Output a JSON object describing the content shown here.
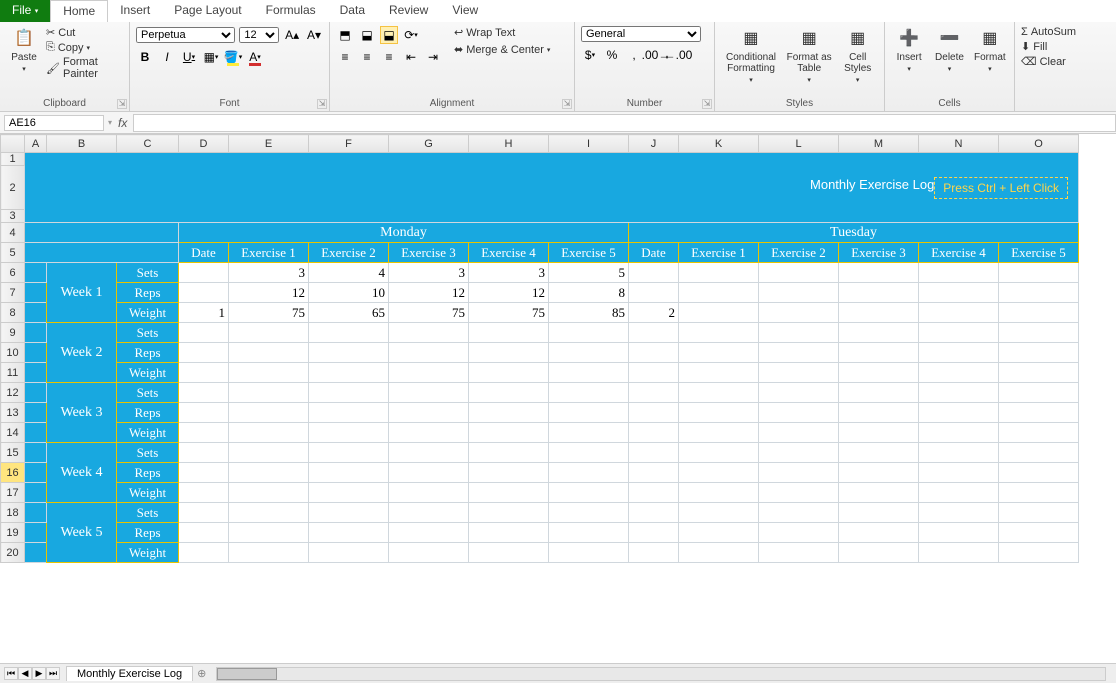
{
  "menu": {
    "file": "File",
    "tabs": [
      "Home",
      "Insert",
      "Page Layout",
      "Formulas",
      "Data",
      "Review",
      "View"
    ],
    "active": "Home"
  },
  "ribbon": {
    "clipboard": {
      "paste": "Paste",
      "cut": "Cut",
      "copy": "Copy",
      "painter": "Format Painter",
      "label": "Clipboard"
    },
    "font": {
      "name": "Perpetua",
      "size": "12",
      "bold": "B",
      "italic": "I",
      "underline": "U",
      "label": "Font"
    },
    "alignment": {
      "wrap": "Wrap Text",
      "merge": "Merge & Center",
      "label": "Alignment"
    },
    "number": {
      "format": "General",
      "currency": "$",
      "percent": "%",
      "comma": ",",
      "label": "Number"
    },
    "styles": {
      "cond": "Conditional Formatting",
      "table": "Format as Table",
      "cell": "Cell Styles",
      "label": "Styles"
    },
    "cells": {
      "insert": "Insert",
      "delete": "Delete",
      "format": "Format",
      "label": "Cells"
    },
    "editing": {
      "autosum": "AutoSum",
      "fill": "Fill",
      "clear": "Clear"
    }
  },
  "formula_bar": {
    "name_box": "AE16",
    "fx": "fx"
  },
  "columns": [
    "A",
    "B",
    "C",
    "D",
    "E",
    "F",
    "G",
    "H",
    "I",
    "J",
    "K",
    "L",
    "M",
    "N",
    "O"
  ],
  "sheet": {
    "title": "Monthly Exercise Log",
    "hint": "Press Ctrl + Left Click",
    "days": [
      "Monday",
      "Tuesday"
    ],
    "sub": [
      "Date",
      "Exercise 1",
      "Exercise 2",
      "Exercise 3",
      "Exercise 4",
      "Exercise 5"
    ],
    "weeks": [
      "Week 1",
      "Week 2",
      "Week 3",
      "Week 4",
      "Week 5"
    ],
    "metrics": [
      "Sets",
      "Reps",
      "Weight"
    ],
    "data": {
      "week1_monday": {
        "date": 1,
        "sets": [
          3,
          4,
          3,
          3,
          5
        ],
        "reps": [
          12,
          10,
          12,
          12,
          8
        ],
        "weight": [
          75,
          65,
          75,
          75,
          85
        ]
      },
      "week1_tuesday": {
        "date": 2
      }
    }
  },
  "tabs": {
    "sheet": "Monthly Exercise Log"
  }
}
